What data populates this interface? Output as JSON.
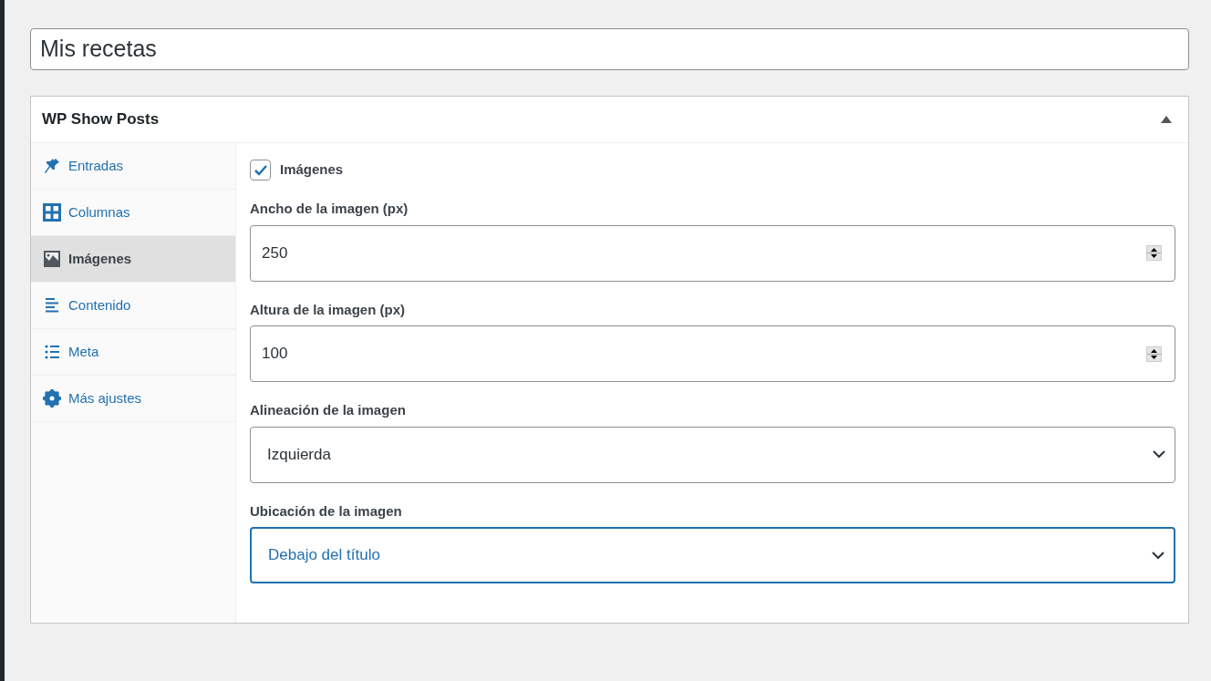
{
  "title_field": {
    "value": "Mis recetas"
  },
  "panel": {
    "title": "WP Show Posts",
    "expanded": true
  },
  "tabs": [
    {
      "label": "Entradas",
      "selected": false
    },
    {
      "label": "Columnas",
      "selected": false
    },
    {
      "label": "Imágenes",
      "selected": true
    },
    {
      "label": "Contenido",
      "selected": false
    },
    {
      "label": "Meta",
      "selected": false
    },
    {
      "label": "Más ajustes",
      "selected": false
    }
  ],
  "checkbox": {
    "label": "Imágenes",
    "checked": true
  },
  "fields": [
    {
      "kind": "number",
      "label": "Ancho de la imagen (px)",
      "value": "250",
      "focused": false
    },
    {
      "kind": "number",
      "label": "Altura de la imagen (px)",
      "value": "100",
      "focused": false
    },
    {
      "kind": "select",
      "label": "Alineación de la imagen",
      "value": "Izquierda",
      "focused": false
    },
    {
      "kind": "select",
      "label": "Ubicación de la imagen",
      "value": "Debajo del título",
      "focused": true
    }
  ]
}
